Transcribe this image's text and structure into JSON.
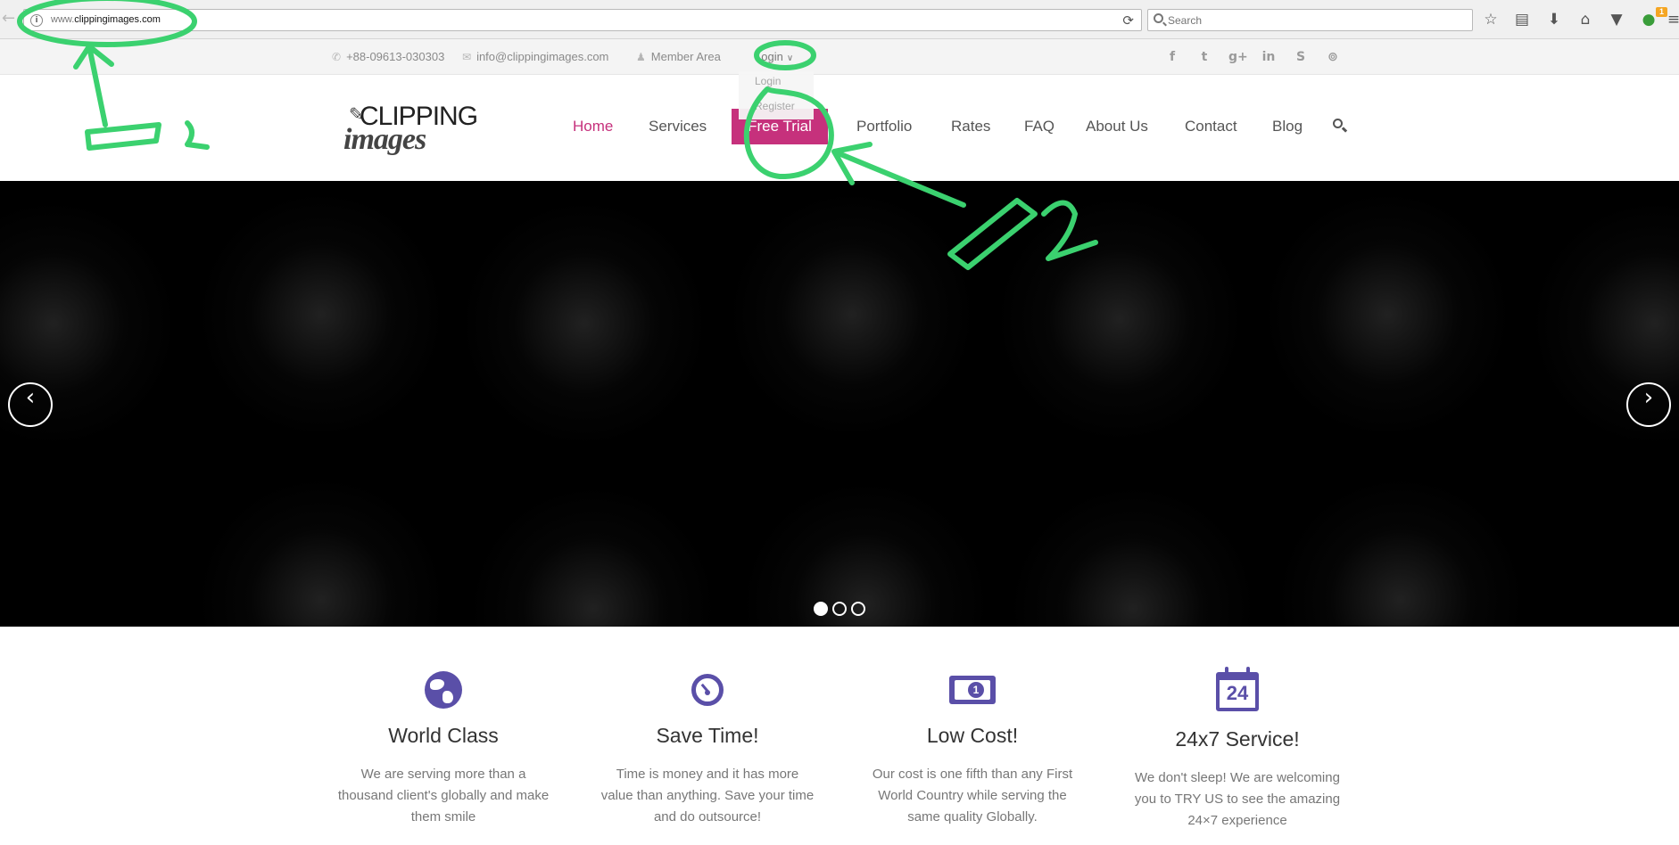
{
  "browser": {
    "url_prefix": "www.",
    "url_domain": "clippingimages.com",
    "search_placeholder": "Search",
    "badge_count": "1"
  },
  "topbar": {
    "phone": "+88-09613-030303",
    "email": "info@clippingimages.com",
    "member_area": "Member Area",
    "login": "Login",
    "social_icons": [
      "facebook-icon",
      "twitter-icon",
      "google-plus-icon",
      "linkedin-icon",
      "skype-icon",
      "rss-icon"
    ]
  },
  "login_menu": {
    "items": [
      "Login",
      "Register"
    ]
  },
  "logo": {
    "line1": "CLIPPING",
    "line2": "images"
  },
  "nav": {
    "items": [
      "Home",
      "Services",
      "Free Trial",
      "Portfolio",
      "Rates",
      "FAQ",
      "About Us",
      "Contact",
      "Blog"
    ],
    "active": "Home"
  },
  "slider": {
    "active_slide": 1,
    "slide_count": 3
  },
  "features": [
    {
      "icon": "globe-icon",
      "title": "World Class",
      "text": "We are serving more than a thousand client's globally and make them smile"
    },
    {
      "icon": "stopwatch-icon",
      "title": "Save Time!",
      "text": "Time is money and it has more value than anything. Save your time and do outsource!"
    },
    {
      "icon": "money-icon",
      "title": "Low Cost!",
      "text": "Our cost is one fifth than any First World Country while serving the same quality Globally."
    },
    {
      "icon": "calendar-24-icon",
      "title": "24x7 Service!",
      "text": "We don't sleep! We are welcoming you to TRY US to see the amazing 24×7 experience"
    }
  ],
  "annotations": {
    "label1": "1",
    "label2": "2",
    "color": "#3bd16f"
  },
  "colors": {
    "accent": "#c6317c",
    "icon_purple": "#5a4fa8"
  }
}
